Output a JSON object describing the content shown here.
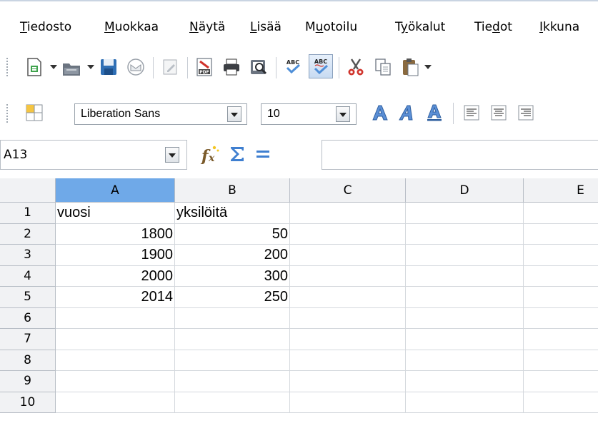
{
  "menu": [
    {
      "pre": "",
      "u": "T",
      "post": "iedosto"
    },
    {
      "pre": "",
      "u": "M",
      "post": "uokkaa"
    },
    {
      "pre": "",
      "u": "N",
      "post": "äytä"
    },
    {
      "pre": "",
      "u": "L",
      "post": "isää"
    },
    {
      "pre": "M",
      "u": "u",
      "post": "otoilu"
    },
    {
      "pre": "T",
      "u": "y",
      "post": "ökalut"
    },
    {
      "pre": "Tie",
      "u": "d",
      "post": "ot"
    },
    {
      "pre": "",
      "u": "I",
      "post": "kkuna"
    }
  ],
  "font": {
    "name": "Liberation Sans",
    "size": "10"
  },
  "namebox": "A13",
  "formula": "",
  "columns": [
    "A",
    "B",
    "C",
    "D",
    "E"
  ],
  "rows": [
    {
      "n": "1",
      "a": "vuosi",
      "b": "yksilöitä"
    },
    {
      "n": "2",
      "a": "1800",
      "b": "50"
    },
    {
      "n": "3",
      "a": "1900",
      "b": "200"
    },
    {
      "n": "4",
      "a": "2000",
      "b": "300"
    },
    {
      "n": "5",
      "a": "2014",
      "b": "250"
    },
    {
      "n": "6",
      "a": "",
      "b": ""
    },
    {
      "n": "7",
      "a": "",
      "b": ""
    },
    {
      "n": "8",
      "a": "",
      "b": ""
    },
    {
      "n": "9",
      "a": "",
      "b": ""
    },
    {
      "n": "10",
      "a": "",
      "b": ""
    }
  ],
  "colors": {
    "selected_header": "#6fa9e8",
    "header_bg": "#f1f2f4"
  }
}
